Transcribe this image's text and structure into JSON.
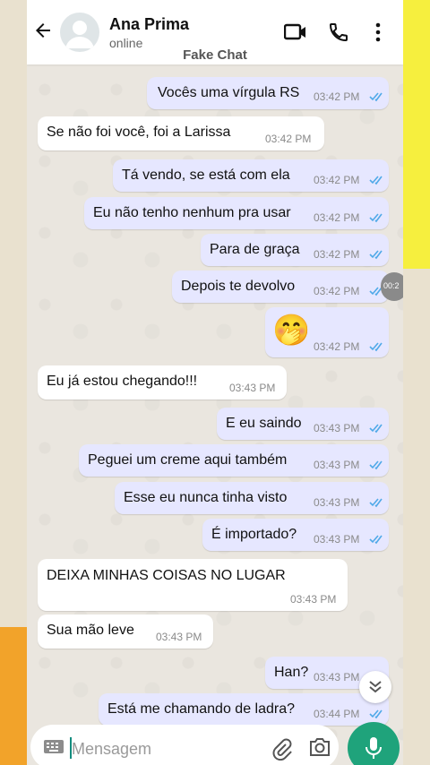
{
  "header": {
    "contact_name": "Ana Prima",
    "status": "online",
    "watermark": "Fake Chat",
    "icons": [
      "back-arrow-icon",
      "video-call-icon",
      "phone-call-icon",
      "more-options-icon"
    ]
  },
  "messages": [
    {
      "dir": "out",
      "text": "Vocês uma vírgula RS",
      "time": "03:42 PM"
    },
    {
      "dir": "in",
      "text": "Se não foi você, foi a Larissa",
      "time": "03:42 PM"
    },
    {
      "dir": "out",
      "text": "Tá vendo, se está com ela",
      "time": "03:42 PM"
    },
    {
      "dir": "out",
      "text": "Eu não tenho nenhum pra usar",
      "time": "03:42 PM"
    },
    {
      "dir": "out",
      "text": "Para de graça",
      "time": "03:42 PM"
    },
    {
      "dir": "out",
      "text": "Depois te devolvo",
      "time": "03:42 PM"
    },
    {
      "dir": "out",
      "text": "🤭",
      "time": "03:42 PM"
    },
    {
      "dir": "in",
      "text": "Eu já estou chegando!!!",
      "time": "03:43 PM"
    },
    {
      "dir": "out",
      "text": "E eu saindo",
      "time": "03:43 PM"
    },
    {
      "dir": "out",
      "text": "Peguei um creme aqui também",
      "time": "03:43 PM"
    },
    {
      "dir": "out",
      "text": "Esse eu nunca tinha visto",
      "time": "03:43 PM"
    },
    {
      "dir": "out",
      "text": "É importado?",
      "time": "03:43 PM"
    },
    {
      "dir": "in",
      "text": "DEIXA MINHAS COISAS NO LUGAR",
      "time": "03:43 PM"
    },
    {
      "dir": "in",
      "text": "Sua mão leve",
      "time": "03:43 PM"
    },
    {
      "dir": "out",
      "text": "Han?",
      "time": "03:43 PM"
    },
    {
      "dir": "out",
      "text": "Está me chamando de ladra?",
      "time": "03:44 PM"
    }
  ],
  "side_bubble_text": "00:2",
  "composer": {
    "placeholder": "Mensagem",
    "icons": [
      "keyboard-icon",
      "attach-icon",
      "camera-icon",
      "mic-icon"
    ]
  },
  "colors": {
    "outgoing_bubble": "#e6e7ff",
    "incoming_bubble": "#ffffff",
    "read_ticks": "#4fa9e8",
    "mic_button": "#1fa37b"
  }
}
